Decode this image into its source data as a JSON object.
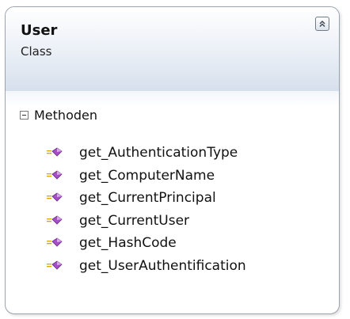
{
  "class": {
    "name": "User",
    "stereotype": "Class"
  },
  "section": {
    "label": "Methoden"
  },
  "methods": [
    {
      "label": "get_AuthenticationType",
      "icon": "method-icon"
    },
    {
      "label": "get_ComputerName",
      "icon": "method-icon"
    },
    {
      "label": "get_CurrentPrincipal",
      "icon": "method-icon"
    },
    {
      "label": "get_CurrentUser",
      "icon": "method-icon"
    },
    {
      "label": "get_HashCode",
      "icon": "method-icon"
    },
    {
      "label": "get_UserAuthentification",
      "icon": "method-icon"
    }
  ],
  "colors": {
    "header_gradient_end": "#d6e0ec",
    "border": "#9aa3ae",
    "method_icon": "#a64ec8"
  }
}
